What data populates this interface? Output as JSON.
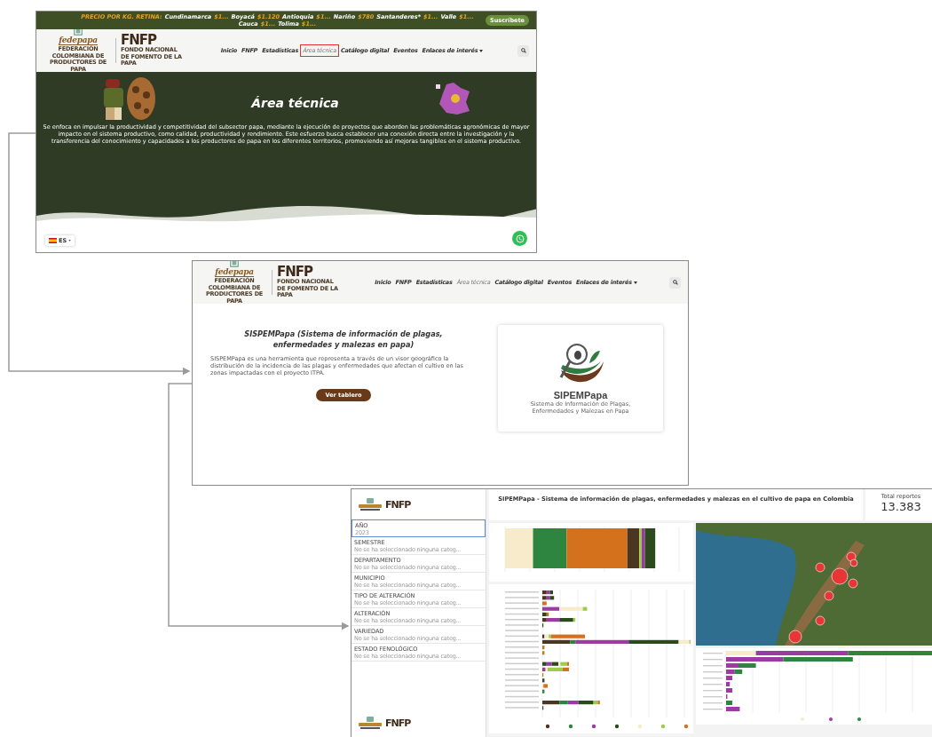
{
  "site_page": {
    "ticker": {
      "label": "PRECIO POR KG. RETINA:",
      "items": [
        {
          "region": "Cundinamarca",
          "price": "$1..."
        },
        {
          "region": "Boyacá",
          "price": "$1.120"
        },
        {
          "region": "Antioquia",
          "price": "$1..."
        },
        {
          "region": "Nariño",
          "price": "$780"
        },
        {
          "region": "Santanderes*",
          "price": "$1..."
        },
        {
          "region": "Valle",
          "price": "$1..."
        },
        {
          "region": "Cauca",
          "price": "$1..."
        },
        {
          "region": "Tolima",
          "price": "$1..."
        }
      ]
    },
    "subscribe_button": "Suscríbete",
    "header": {
      "org_name": "fedepapa",
      "org_caption": "FEDERACIÓN COLOMBIANA DE PRODUCTORES DE PAPA",
      "brand": "FNFP",
      "brand_caption": "FONDO NACIONAL DE FOMENTO DE LA PAPA",
      "nav": [
        {
          "label": "Inicio",
          "selected": false,
          "highlighted": false,
          "has_menu": false
        },
        {
          "label": "FNFP",
          "selected": false,
          "highlighted": false,
          "has_menu": false
        },
        {
          "label": "Estadísticas",
          "selected": false,
          "highlighted": false,
          "has_menu": false
        },
        {
          "label": "Área técnica",
          "selected": true,
          "highlighted": true,
          "has_menu": false
        },
        {
          "label": "Catálogo digital",
          "selected": false,
          "highlighted": false,
          "has_menu": false
        },
        {
          "label": "Eventos",
          "selected": false,
          "highlighted": false,
          "has_menu": false
        },
        {
          "label": "Enlaces de interés",
          "selected": false,
          "highlighted": false,
          "has_menu": true
        }
      ]
    },
    "hero": {
      "title": "Área técnica",
      "text": "Se enfoca en impulsar la productividad y competitividad del subsector papa, mediante la ejecución de proyectos que aborden las problemáticas agronómicas de mayor impacto en el sistema productivo, como calidad, productividad y rendimiento. Este esfuerzo busca establecer una conexión directa entre la investigación y la transferencia del conocimiento y capacidades a los productores de papa en los diferentes territorios, promoviendo así mejoras tangibles en el sistema productivo."
    },
    "language": "ES"
  },
  "sispem_page": {
    "header": {
      "org_name": "fedepapa",
      "org_caption": "FEDERACIÓN COLOMBIANA DE PRODUCTORES DE PAPA",
      "brand": "FNFP",
      "brand_caption": "FONDO NACIONAL DE FOMENTO DE LA PAPA",
      "nav": [
        {
          "label": "Inicio",
          "selected": false,
          "highlighted": false,
          "has_menu": false
        },
        {
          "label": "FNFP",
          "selected": false,
          "highlighted": false,
          "has_menu": false
        },
        {
          "label": "Estadísticas",
          "selected": false,
          "highlighted": false,
          "has_menu": false
        },
        {
          "label": "Área técnica",
          "selected": true,
          "highlighted": false,
          "has_menu": false
        },
        {
          "label": "Catálogo digital",
          "selected": false,
          "highlighted": false,
          "has_menu": false
        },
        {
          "label": "Eventos",
          "selected": false,
          "highlighted": false,
          "has_menu": false
        },
        {
          "label": "Enlaces de interés",
          "selected": false,
          "highlighted": false,
          "has_menu": true
        }
      ]
    },
    "heading": "SISPEMPapa (Sistema de información de plagas, enfermedades y malezas en papa)",
    "description": "SISPEMPapa es una herramienta que representa a través de un visor geográfico la distribución de la incidencia de las plagas y enfermedades que afectan el cultivo en las zonas impactadas con el proyecto ITPA.",
    "button": "Ver tablero",
    "logo_card": {
      "name": "SIPEMPapa",
      "caption": "Sistema de Información de Plagas, Enfermedades y Malezas en Papa"
    }
  },
  "dashboard": {
    "sidebar_logo": "FNFP",
    "footer_logo": "FNFP",
    "title": "SIPEMPapa - Sistema de información de plagas, enfermedades y malezas en el cultivo de papa en Colombia",
    "total": {
      "label": "Total reportes",
      "value": "13.383"
    },
    "filters": [
      {
        "label": "AÑO",
        "value": "2023",
        "selected": true
      },
      {
        "label": "SEMESTRE",
        "value": "No se ha seleccionado ninguna categ...",
        "selected": false
      },
      {
        "label": "DEPARTAMENTO",
        "value": "No se ha seleccionado ninguna categ...",
        "selected": false
      },
      {
        "label": "MUNICIPIO",
        "value": "No se ha seleccionado ninguna categ...",
        "selected": false
      },
      {
        "label": "TIPO DE ALTERACIÓN",
        "value": "No se ha seleccionado ninguna categ...",
        "selected": false
      },
      {
        "label": "ALTERACIÓN",
        "value": "No se ha seleccionado ninguna categ...",
        "selected": false
      },
      {
        "label": "VARIEDAD",
        "value": "No se ha seleccionado ninguna categ...",
        "selected": false
      },
      {
        "label": "ESTADO FENOLÓGICO",
        "value": "No se ha seleccionado ninguna categ...",
        "selected": false
      }
    ]
  }
}
